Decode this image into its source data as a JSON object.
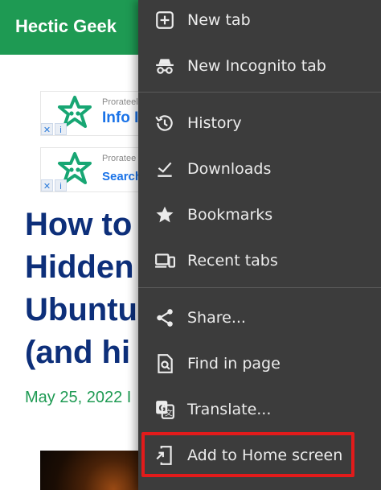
{
  "site": {
    "title": "Hectic Geek",
    "brand_color": "#1e9a53"
  },
  "ads": [
    {
      "small": "Prorateel",
      "big": "Info I"
    },
    {
      "small": "Proratee",
      "big": "Search"
    }
  ],
  "article": {
    "headline_lines": [
      "How to",
      "Hidden",
      "Ubuntu",
      "(and hi"
    ],
    "date": "May 25, 2022 I"
  },
  "menu": {
    "items": [
      {
        "label": "New tab",
        "icon": "new-tab-icon"
      },
      {
        "label": "New Incognito tab",
        "icon": "incognito-icon"
      },
      {
        "label": "History",
        "icon": "history-icon"
      },
      {
        "label": "Downloads",
        "icon": "downloads-icon"
      },
      {
        "label": "Bookmarks",
        "icon": "bookmarks-star-icon"
      },
      {
        "label": "Recent tabs",
        "icon": "recent-tabs-devices-icon"
      },
      {
        "label": "Share...",
        "icon": "share-icon"
      },
      {
        "label": "Find in page",
        "icon": "find-in-page-icon"
      },
      {
        "label": "Translate...",
        "icon": "translate-icon"
      },
      {
        "label": "Add to Home screen",
        "icon": "add-to-home-screen-icon"
      }
    ],
    "background": "#3c3c3c",
    "highlight_color": "#e21b1b"
  }
}
